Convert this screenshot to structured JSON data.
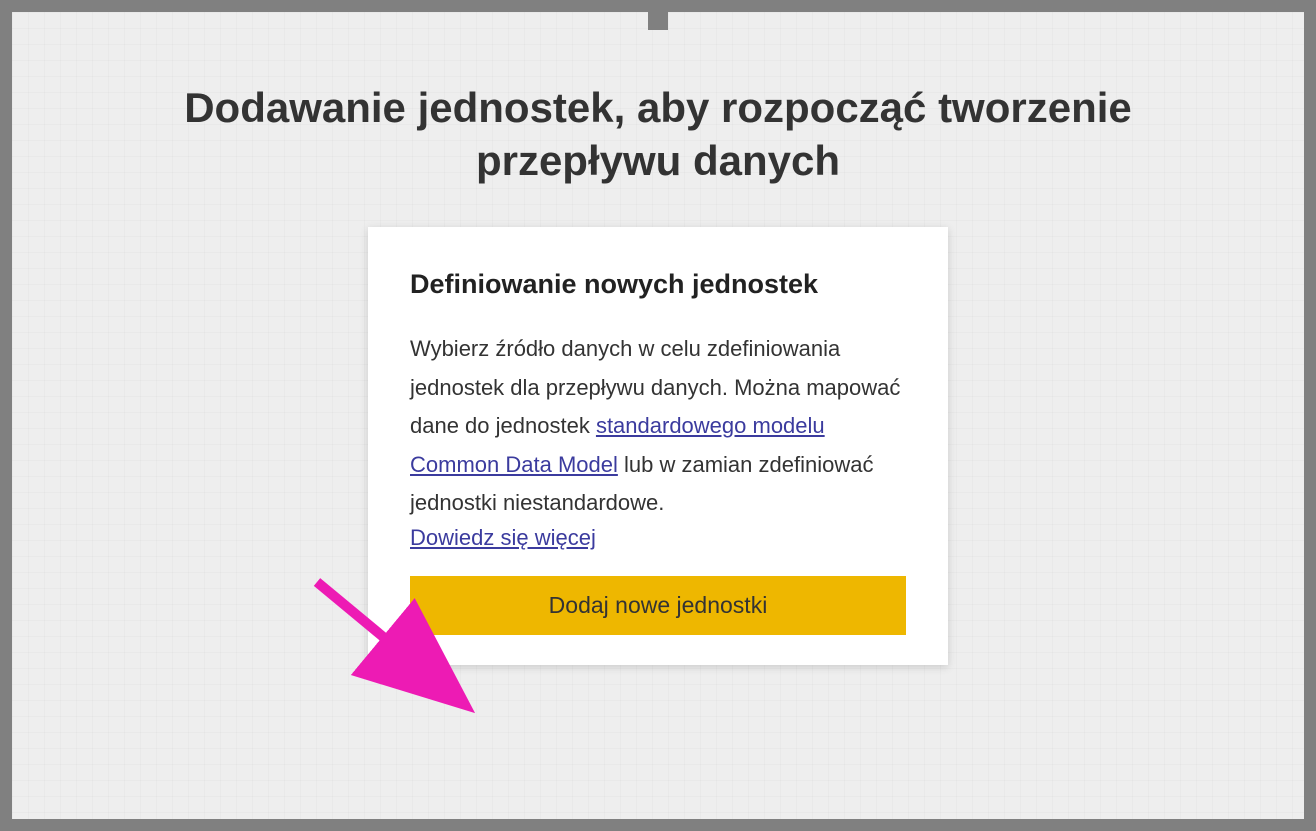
{
  "page": {
    "title": "Dodawanie jednostek, aby rozpocząć tworzenie przepływu danych"
  },
  "card": {
    "title": "Definiowanie nowych jednostek",
    "description_part1": "Wybierz źródło danych w celu zdefiniowania jednostek dla przepływu danych. Można mapować dane do jednostek ",
    "cdm_link_text": "standardowego modelu Common Data Model",
    "description_part2": " lub w zamian zdefiniować jednostki niestandardowe.",
    "learn_more_label": "Dowiedz się więcej",
    "button_label": "Dodaj nowe jednostki"
  },
  "colors": {
    "accent": "#eeb700",
    "link": "#3b3b9e",
    "arrow": "#ed1bb4"
  }
}
